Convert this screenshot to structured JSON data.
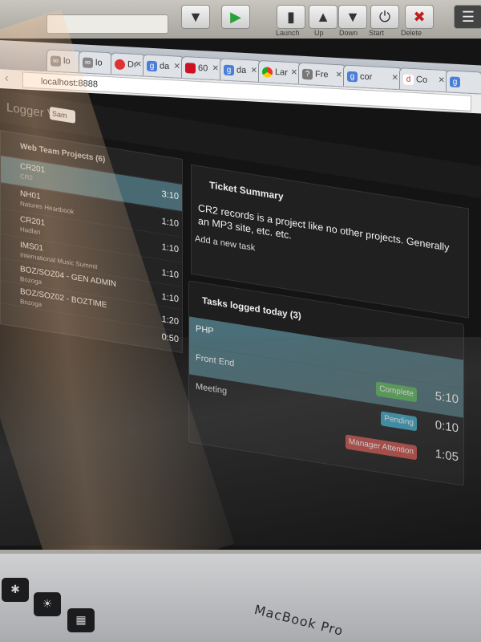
{
  "browser": {
    "toolbar_captions": [
      "Launch",
      "Up",
      "Down",
      "Start",
      "Delete"
    ],
    "tabs": [
      {
        "label": "lo",
        "icon": "link-icon"
      },
      {
        "label": "lo",
        "icon": "link-icon"
      },
      {
        "label": "Dr",
        "icon": "red-circle-icon"
      },
      {
        "label": "da",
        "icon": "google-icon"
      },
      {
        "label": "60",
        "icon": "red-square-icon"
      },
      {
        "label": "da",
        "icon": "google-icon"
      },
      {
        "label": "Lar",
        "icon": "chrome-icon"
      },
      {
        "label": "Fre",
        "icon": "freelancer-icon"
      },
      {
        "label": "cor",
        "icon": "google-icon"
      },
      {
        "label": "Co",
        "icon": "red-d-icon"
      },
      {
        "label": "",
        "icon": "google-icon"
      }
    ],
    "address": "localhost:8888"
  },
  "app": {
    "title": "Logger V2",
    "user_select": "Sam"
  },
  "projects": {
    "title": "Web Team Projects (6)",
    "rows": [
      {
        "code": "CR201",
        "sub": "CR2",
        "time": "3:10"
      },
      {
        "code": "NH01",
        "sub": "Natures Heartbook",
        "time": "1:10"
      },
      {
        "code": "CR201",
        "sub": "Hadlan",
        "time": "1:10"
      },
      {
        "code": "IMS01",
        "sub": "International Music Summit",
        "time": "1:10"
      },
      {
        "code": "BOZ/SOZ04 - GEN ADMIN",
        "sub": "Bozoga",
        "time": "1:10"
      },
      {
        "code": "BOZ/SOZ02 - BOZTIME",
        "sub": "Bozoga",
        "time": "1:20"
      },
      {
        "code": "",
        "sub": "",
        "time": "0:50"
      }
    ]
  },
  "summary": {
    "title": "Ticket Summary",
    "body": "CR2 records is a project like no other projects. Generally an MP3 site, etc. etc.",
    "add_task": "Add a new task"
  },
  "tasks": {
    "title": "Tasks logged today (3)",
    "rows": [
      {
        "name": "PHP",
        "badge": "",
        "badge_color": "",
        "time": ""
      },
      {
        "name": "Front End",
        "badge": "Complete",
        "badge_color": "#5cb85c",
        "time": "5:10"
      },
      {
        "name": "Meeting",
        "badge": "Pending",
        "badge_color": "#3aa6c4",
        "time": "0:10"
      },
      {
        "name": "",
        "badge": "Manager Attention",
        "badge_color": "#c9504a",
        "time": "1:05"
      }
    ]
  },
  "hardware": {
    "brand": "MacBook Pro"
  }
}
